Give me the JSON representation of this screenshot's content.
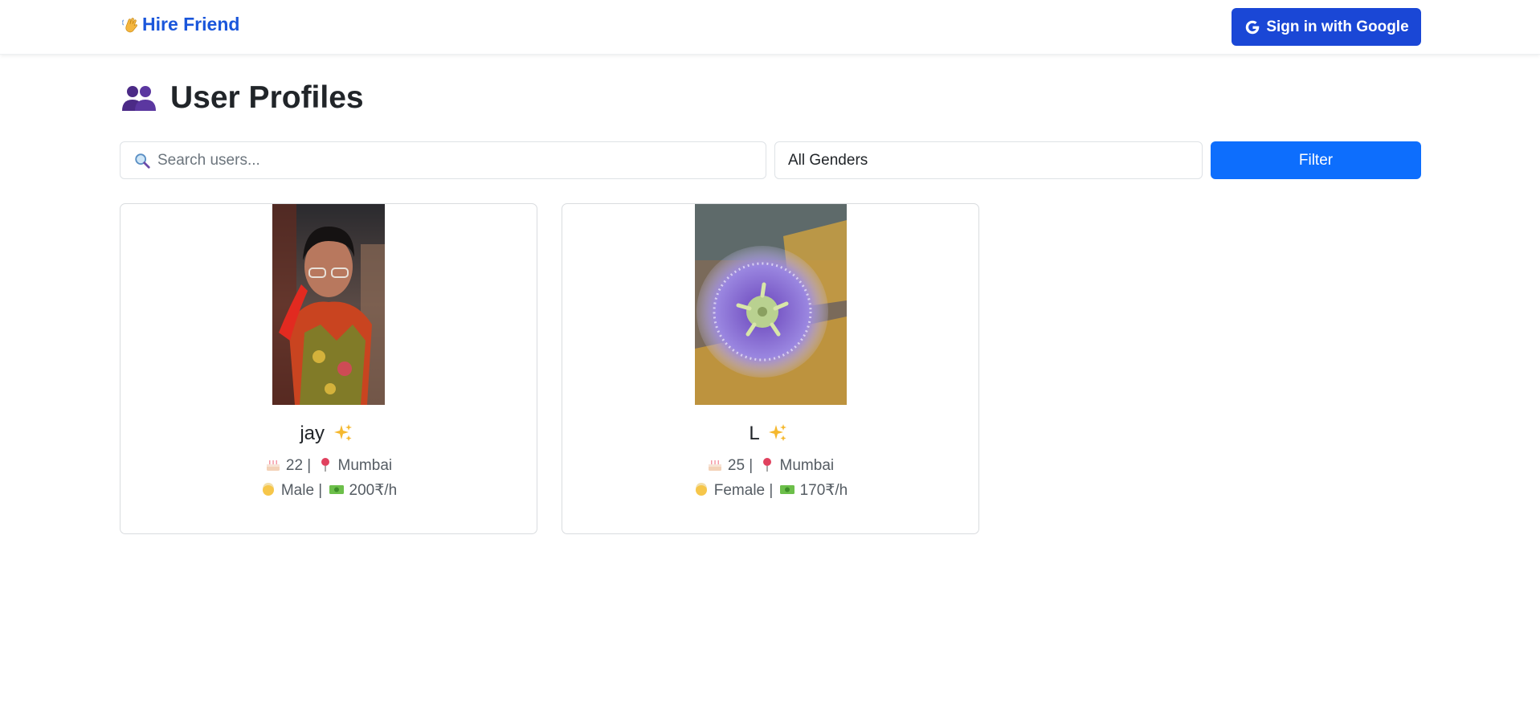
{
  "navbar": {
    "brand_icon": "waving-hand-icon",
    "brand_label": "Hire Friend",
    "signin_icon": "google-g-icon",
    "signin_label": "Sign in with Google"
  },
  "page": {
    "title_icon": "two-people-icon",
    "title": "User Profiles"
  },
  "filters": {
    "search_icon": "magnifying-glass-icon",
    "search_placeholder": "Search users...",
    "gender_selected": "All Genders",
    "filter_label": "Filter"
  },
  "profiles": [
    {
      "name": "jay",
      "name_icon": "sparkles-icon",
      "age": "22",
      "city": "Mumbai",
      "gender": "Male",
      "rate": "200₹/h",
      "photo": "portrait-photo"
    },
    {
      "name": "L",
      "name_icon": "sparkles-icon",
      "age": "25",
      "city": "Mumbai",
      "gender": "Female",
      "rate": "170₹/h",
      "photo": "purple-flower-photo"
    }
  ],
  "colors": {
    "brand": "#1a56db",
    "google_button": "#1a47d6",
    "filter_button": "#0d6efd"
  }
}
